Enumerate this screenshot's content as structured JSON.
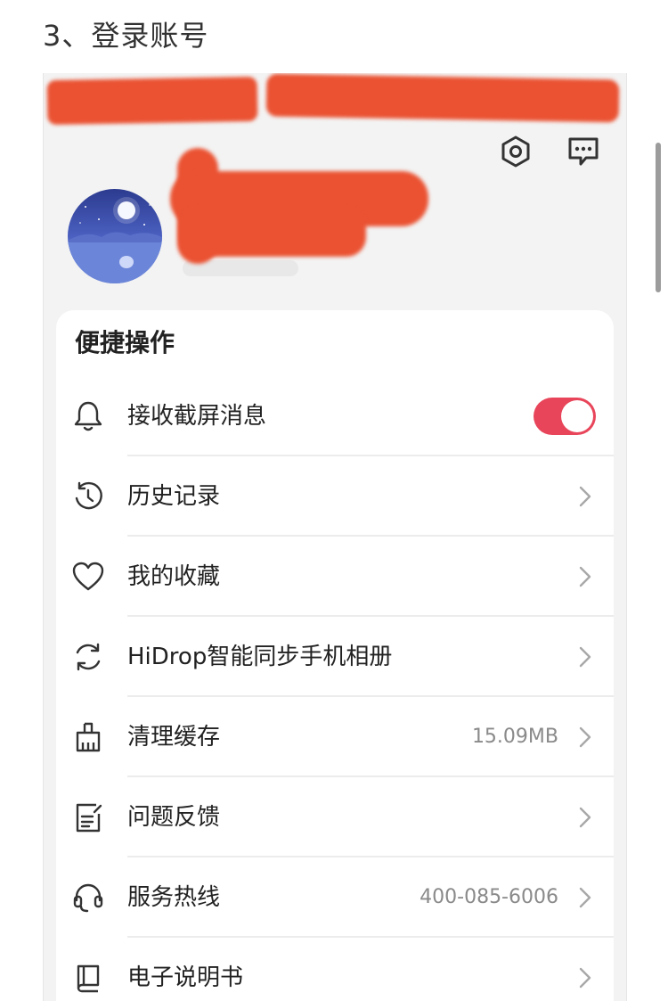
{
  "step_heading": "3、登录账号",
  "header": {
    "settings_icon": "hexagon-settings-icon",
    "message_icon": "chat-bubble-icon"
  },
  "profile": {
    "avatar_description_icon": "night-moon-lake-avatar"
  },
  "card": {
    "title": "便捷操作",
    "items": [
      {
        "icon": "bell-icon",
        "label": "接收截屏消息",
        "value": "",
        "control": "toggle",
        "toggle_on": true
      },
      {
        "icon": "history-clock-icon",
        "label": "历史记录",
        "value": "",
        "control": "chevron"
      },
      {
        "icon": "heart-icon",
        "label": "我的收藏",
        "value": "",
        "control": "chevron"
      },
      {
        "icon": "sync-icon",
        "label": "HiDrop智能同步手机相册",
        "value": "",
        "control": "chevron"
      },
      {
        "icon": "broom-icon",
        "label": "清理缓存",
        "value": "15.09MB",
        "control": "chevron"
      },
      {
        "icon": "feedback-document-icon",
        "label": "问题反馈",
        "value": "",
        "control": "chevron"
      },
      {
        "icon": "headset-icon",
        "label": "服务热线",
        "value": "400-085-6006",
        "control": "chevron"
      },
      {
        "icon": "manual-book-icon",
        "label": "电子说明书",
        "value": "",
        "control": "chevron"
      }
    ]
  },
  "colors": {
    "accent": "#e8455a",
    "redaction": "#ea5232",
    "card_background": "#ffffff",
    "page_background": "#f3f3f3",
    "icon": "#333333",
    "muted_text": "#8a8a8a"
  }
}
